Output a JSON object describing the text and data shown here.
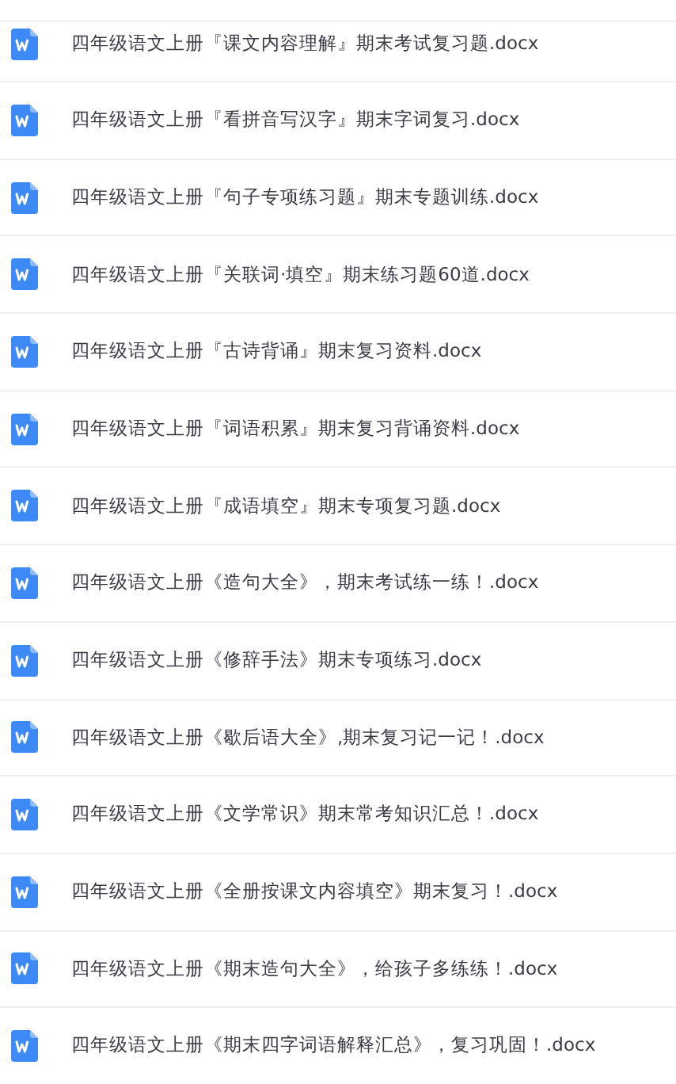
{
  "files": [
    {
      "name": "四年级语文上册『课文内容理解』期末考试复习题.docx"
    },
    {
      "name": "四年级语文上册『看拼音写汉字』期末字词复习.docx"
    },
    {
      "name": "四年级语文上册『句子专项练习题』期末专题训练.docx"
    },
    {
      "name": "四年级语文上册『关联词·填空』期末练习题60道.docx"
    },
    {
      "name": "四年级语文上册『古诗背诵』期末复习资料.docx"
    },
    {
      "name": "四年级语文上册『词语积累』期末复习背诵资料.docx"
    },
    {
      "name": "四年级语文上册『成语填空』期末专项复习题.docx"
    },
    {
      "name": "四年级语文上册《造句大全》，期末考试练一练！.docx"
    },
    {
      "name": "四年级语文上册《修辞手法》期末专项练习.docx"
    },
    {
      "name": "四年级语文上册《歇后语大全》,期末复习记一记！.docx"
    },
    {
      "name": "四年级语文上册《文学常识》期末常考知识汇总！.docx"
    },
    {
      "name": "四年级语文上册《全册按课文内容填空》期末复习！.docx"
    },
    {
      "name": "四年级语文上册《期末造句大全》，给孩子多练练！.docx"
    },
    {
      "name": "四年级语文上册《期末四字词语解释汇总》，复习巩固！.docx"
    }
  ]
}
